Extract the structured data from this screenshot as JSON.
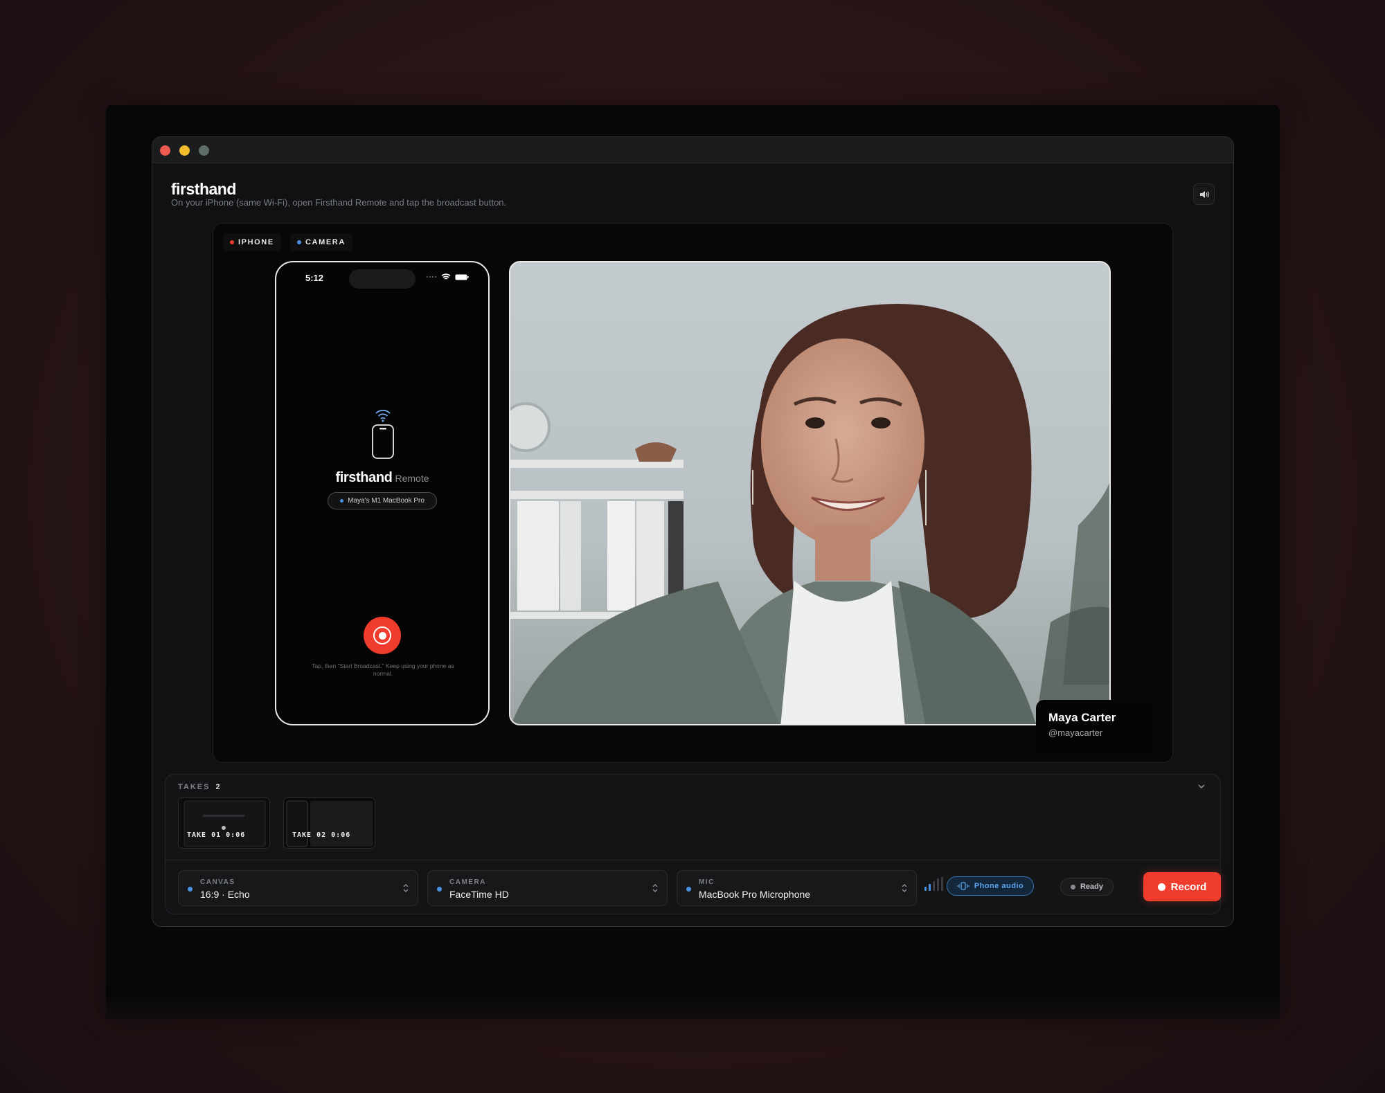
{
  "app": {
    "brand": "firsthand",
    "subtitle": "On your iPhone (same Wi-Fi), open Firsthand Remote and tap the broadcast button."
  },
  "stage": {
    "tags": [
      {
        "label": "IPHONE",
        "color": "#ef3c2c"
      },
      {
        "label": "CAMERA",
        "color": "#4a90e2"
      }
    ],
    "phone": {
      "time": "5:12",
      "app_name": "firsthand",
      "app_suffix": "Remote",
      "device_pill": "Maya's M1 MacBook Pro",
      "hint": "Tap, then \"Start Broadcast.\" Keep using your phone as normal."
    },
    "camera": {
      "name": "Maya Carter",
      "handle": "@mayacarter"
    }
  },
  "takes": {
    "label": "TAKES",
    "count": "2",
    "items": [
      {
        "label": "TAKE 01 0:06"
      },
      {
        "label": "TAKE 02 0:06"
      }
    ]
  },
  "controls": {
    "canvas": {
      "caption": "CANVAS",
      "value": "16:9 · Echo"
    },
    "camera": {
      "caption": "CAMERA",
      "value": "FaceTime HD"
    },
    "mic": {
      "caption": "MIC",
      "value": "MacBook Pro Microphone"
    },
    "phone_audio": "Phone audio",
    "status": "Ready",
    "record": "Record"
  },
  "colors": {
    "accent_red": "#ef3c2c",
    "accent_blue": "#4a90e2"
  }
}
